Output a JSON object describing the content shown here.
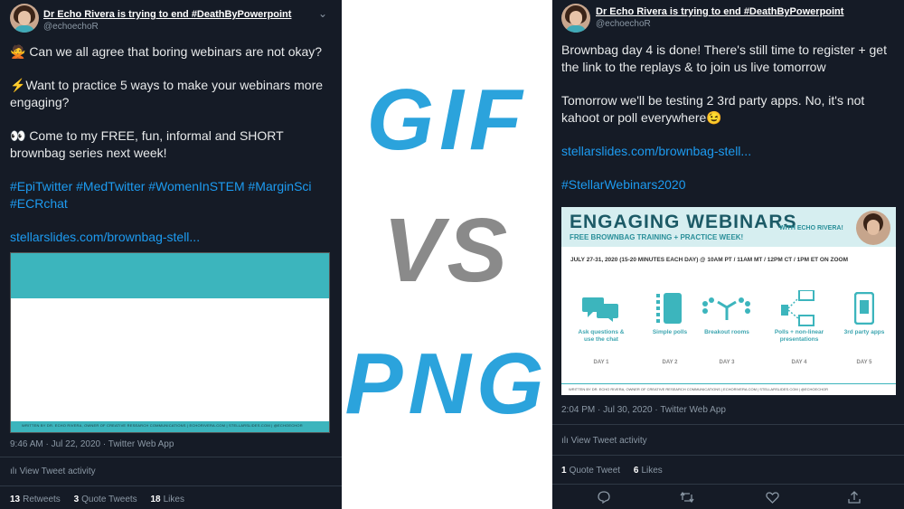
{
  "left_tweet": {
    "display_name": "Dr Echo Rivera is trying to end #DeathByPowerpoint",
    "handle": "@echoechoR",
    "line1": "🙅 Can we all agree that boring webinars are not okay?",
    "line2": "⚡Want to practice 5 ways to make your webinars more engaging?",
    "line3": "👀 Come to my FREE, fun, informal and SHORT brownbag series next week!",
    "hashtags": "#EpiTwitter #MedTwitter #WomenInSTEM #MarginSci #ECRchat",
    "link": "stellarslides.com/brownbag-stell...",
    "card_footer": "WRITTEN BY DR. ECHO RIVERA, OWNER OF CREATIVE RESEARCH COMMUNICATIONS | ECHORIVERA.COM | STELLARSLIDES.COM | @ECHOECHOR",
    "timestamp": "9:46 AM · Jul 22, 2020 · Twitter Web App",
    "activity": "View Tweet activity",
    "retweets_count": "13",
    "retweets_label": "Retweets",
    "quotes_count": "3",
    "quotes_label": "Quote Tweets",
    "likes_count": "18",
    "likes_label": "Likes"
  },
  "right_tweet": {
    "display_name": "Dr Echo Rivera is trying to end #DeathByPowerpoint",
    "handle": "@echoechoR",
    "line1": "Brownbag day 4 is done! There's still time to register + get the link to the replays & to join us live tomorrow",
    "line2": "Tomorrow we'll be testing 2 3rd party apps. No, it's not kahoot or poll everywhere😉",
    "link": "stellarslides.com/brownbag-stell...",
    "hashtag": "#StellarWebinars2020",
    "card": {
      "title": "ENGAGING WEBINARS",
      "subtitle": "FREE BROWNBAG TRAINING + PRACTICE WEEK!",
      "with": "WITH ECHO RIVERA!",
      "date_line": "JULY 27-31, 2020 (15-20 MINUTES EACH DAY) @ 10AM PT / 11AM MT / 12PM CT / 1PM ET ON ZOOM",
      "features": [
        {
          "label": "Ask questions & use the chat",
          "day": "DAY 1"
        },
        {
          "label": "Simple polls",
          "day": "DAY 2"
        },
        {
          "label": "Breakout rooms",
          "day": "DAY 3"
        },
        {
          "label": "Polls + non-linear presentations",
          "day": "DAY 4"
        },
        {
          "label": "3rd party apps",
          "day": "DAY 5"
        }
      ],
      "footer": "WRITTEN BY DR. ECHO RIVERA, OWNER OF CREATIVE RESEARCH COMMUNICATIONS | ECHORIVERA.COM | STELLARSLIDES.COM | @ECHOECHOR"
    },
    "timestamp": "2:04 PM · Jul 30, 2020 · Twitter Web App",
    "activity": "View Tweet activity",
    "quotes_count": "1",
    "quotes_label": "Quote Tweet",
    "likes_count": "6",
    "likes_label": "Likes"
  },
  "center": {
    "word1": "GIF",
    "word2": "VS",
    "word3": "PNG"
  },
  "colors": {
    "tweet_bg": "#151b26",
    "link": "#1d9bf0",
    "gif_png_blue": "#2ba3dc",
    "vs_gray": "#8a8a8a",
    "teal": "#3cb5bd"
  }
}
